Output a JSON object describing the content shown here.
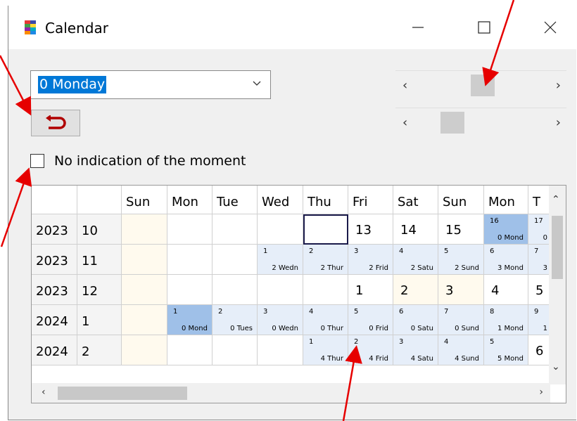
{
  "window": {
    "title": "Calendar",
    "min_icon": "minimize-icon",
    "max_icon": "maximize-icon",
    "close_icon": "close-icon"
  },
  "controls": {
    "combo_value": "0 Monday",
    "checkbox_label": "No indication of the moment",
    "checkbox_checked": false,
    "scroll1_level": 0.45,
    "scroll2_level": 0.2
  },
  "grid": {
    "headers": [
      "",
      "",
      "Sun",
      "Mon",
      "Tue",
      "Wed",
      "Thu",
      "Fri",
      "Sat",
      "Sun",
      "Mon",
      "T"
    ],
    "rows": [
      {
        "year": "2023",
        "month": "10"
      },
      {
        "year": "2023",
        "month": "11"
      },
      {
        "year": "2023",
        "month": "12"
      },
      {
        "year": "2024",
        "month": "1"
      },
      {
        "year": "2024",
        "month": "2"
      }
    ],
    "cells": [
      [
        {
          "t": "cream"
        },
        {
          "t": "w"
        },
        {
          "t": "w"
        },
        {
          "t": "w"
        },
        {
          "t": "focus"
        },
        {
          "t": "w",
          "big": "13"
        },
        {
          "t": "w",
          "big": "14"
        },
        {
          "t": "w",
          "big": "15"
        },
        {
          "t": "sel",
          "n": "16",
          "s": "0 Mond"
        },
        {
          "t": "light",
          "n": "17",
          "s": "0"
        }
      ],
      [
        {
          "t": "cream"
        },
        {
          "t": "w"
        },
        {
          "t": "w"
        },
        {
          "t": "light",
          "n": "1",
          "s": "2 Wedn"
        },
        {
          "t": "light",
          "n": "2",
          "s": "2 Thur"
        },
        {
          "t": "light",
          "n": "3",
          "s": "2 Frid"
        },
        {
          "t": "light",
          "n": "4",
          "s": "2 Satu"
        },
        {
          "t": "light",
          "n": "5",
          "s": "2 Sund"
        },
        {
          "t": "light",
          "n": "6",
          "s": "3 Mond"
        },
        {
          "t": "light",
          "n": "7",
          "s": "3"
        }
      ],
      [
        {
          "t": "cream"
        },
        {
          "t": "w"
        },
        {
          "t": "w"
        },
        {
          "t": "w"
        },
        {
          "t": "w"
        },
        {
          "t": "w",
          "big": "1"
        },
        {
          "t": "cream",
          "big": "2"
        },
        {
          "t": "cream",
          "big": "3"
        },
        {
          "t": "w",
          "big": "4"
        },
        {
          "t": "w",
          "big": "5"
        }
      ],
      [
        {
          "t": "cream"
        },
        {
          "t": "sel",
          "n": "1",
          "s": "0 Mond"
        },
        {
          "t": "light",
          "n": "2",
          "s": "0 Tues"
        },
        {
          "t": "light",
          "n": "3",
          "s": "0 Wedn"
        },
        {
          "t": "light",
          "n": "4",
          "s": "0 Thur"
        },
        {
          "t": "light",
          "n": "5",
          "s": "0 Frid"
        },
        {
          "t": "light",
          "n": "6",
          "s": "0 Satu"
        },
        {
          "t": "light",
          "n": "7",
          "s": "0 Sund"
        },
        {
          "t": "light",
          "n": "8",
          "s": "1 Mond"
        },
        {
          "t": "light",
          "n": "9",
          "s": "1"
        }
      ],
      [
        {
          "t": "cream"
        },
        {
          "t": "w"
        },
        {
          "t": "w"
        },
        {
          "t": "w"
        },
        {
          "t": "light",
          "n": "1",
          "s": "4 Thur"
        },
        {
          "t": "light",
          "n": "2",
          "s": "4 Frid"
        },
        {
          "t": "light",
          "n": "3",
          "s": "4 Satu"
        },
        {
          "t": "light",
          "n": "4",
          "s": "4 Sund"
        },
        {
          "t": "light",
          "n": "5",
          "s": "5 Mond"
        },
        {
          "t": "w",
          "big": "6"
        }
      ]
    ]
  },
  "colors": {
    "arrow": "#e60000",
    "selection": "#0078d7",
    "cell_selected": "#9fc0e8",
    "cell_light": "#e6eef9",
    "cell_cream": "#fffaee"
  }
}
